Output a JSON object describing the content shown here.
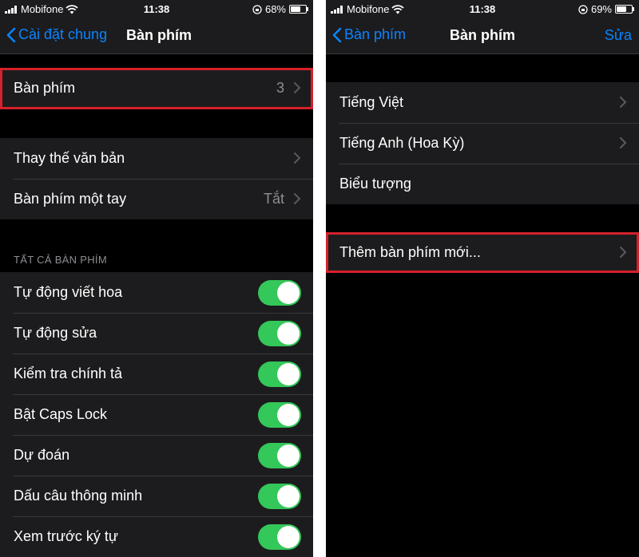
{
  "left": {
    "status": {
      "carrier": "Mobifone",
      "time": "11:38",
      "battery": "68%",
      "battery_level": 0.68
    },
    "nav": {
      "back_label": "Cài đặt chung",
      "title": "Bàn phím"
    },
    "keyboards_row": {
      "label": "Bàn phím",
      "value": "3"
    },
    "text_replacement": {
      "label": "Thay thế văn bản"
    },
    "one_handed": {
      "label": "Bàn phím một tay",
      "value": "Tắt"
    },
    "all_keyboards_header": "TẤT CẢ BÀN PHÍM",
    "toggles": [
      {
        "label": "Tự động viết hoa",
        "on": true
      },
      {
        "label": "Tự động sửa",
        "on": true
      },
      {
        "label": "Kiểm tra chính tả",
        "on": true
      },
      {
        "label": "Bật Caps Lock",
        "on": true
      },
      {
        "label": "Dự đoán",
        "on": true
      },
      {
        "label": "Dấu câu thông minh",
        "on": true
      },
      {
        "label": "Xem trước ký tự",
        "on": true
      }
    ]
  },
  "right": {
    "status": {
      "carrier": "Mobifone",
      "time": "11:38",
      "battery": "69%",
      "battery_level": 0.69
    },
    "nav": {
      "back_label": "Bàn phím",
      "title": "Bàn phím",
      "action": "Sửa"
    },
    "keyboards": [
      {
        "label": "Tiếng Việt"
      },
      {
        "label": "Tiếng Anh (Hoa Kỳ)"
      },
      {
        "label": "Biểu tượng"
      }
    ],
    "add_keyboard": {
      "label": "Thêm bàn phím mới..."
    }
  },
  "colors": {
    "accent": "#0a84ff",
    "toggle_on": "#34c759",
    "highlight": "#d6202a",
    "cell": "#1c1c1e",
    "background": "#000000"
  }
}
